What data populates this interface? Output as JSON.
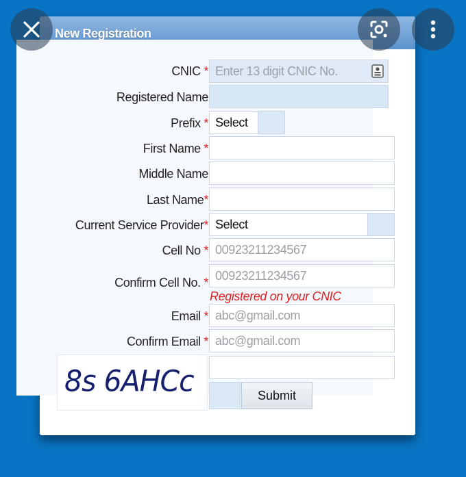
{
  "window": {
    "title": "New Registration"
  },
  "form": {
    "cnic": {
      "label": "CNIC",
      "placeholder": "Enter 13 digit CNIC No."
    },
    "registered_name": {
      "label": "Registered Name"
    },
    "prefix": {
      "label": "Prefix",
      "selected": "Select"
    },
    "first_name": {
      "label": "First Name"
    },
    "middle_name": {
      "label": "Middle Name"
    },
    "last_name": {
      "label": "Last Name"
    },
    "service_provider": {
      "label": "Current Service Provider",
      "selected": "Select"
    },
    "cell_no": {
      "label": "Cell No",
      "placeholder": "00923211234567"
    },
    "confirm_cell": {
      "label": "Confirm Cell No.",
      "placeholder": "00923211234567",
      "note": "Registered on your CNIC"
    },
    "email": {
      "label": "Email",
      "placeholder": "abc@gmail.com"
    },
    "confirm_email": {
      "label": "Confirm Email",
      "placeholder": "abc@gmail.com"
    },
    "required_marker": "*",
    "captcha_text": "8s 6AHCc",
    "submit_label": "Submit"
  },
  "overlay": {
    "close_glyph": "✕",
    "menu_glyph": "⋮"
  },
  "colors": {
    "background": "#0a74c4",
    "required": "#d62222",
    "note": "#e01f1f",
    "captcha": "#16206e"
  }
}
